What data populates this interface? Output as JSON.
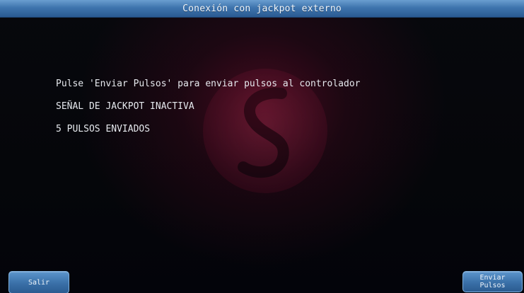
{
  "title": "Conexión con jackpot externo",
  "messages": {
    "instruction": "Pulse 'Enviar Pulsos' para enviar pulsos al controlador",
    "signal_status": "SEÑAL DE JACKPOT INACTIVA",
    "pulses_sent": "5 PULSOS ENVIADOS"
  },
  "buttons": {
    "exit_label": "Salir",
    "send_label_line1": "Enviar",
    "send_label_line2": "Pulsos"
  },
  "icons": {
    "watermark": "brand-s-logo-icon"
  },
  "colors": {
    "titlebar": "#3e74ad",
    "button": "#3a70a8",
    "text": "#e6e9ee",
    "background": "#06070b",
    "glow": "#780e2e"
  }
}
